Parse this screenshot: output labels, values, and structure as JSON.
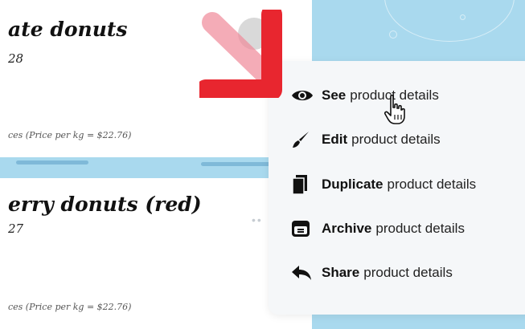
{
  "cards": [
    {
      "title": "ate donuts",
      "code": "28",
      "price": "ces (Price per kg = $22.76)"
    },
    {
      "title": "erry donuts (red)",
      "code": "27",
      "price": "ces (Price per kg = $22.76)"
    }
  ],
  "menu": {
    "items": [
      {
        "bold": "See",
        "rest": "product details",
        "icon": "eye-icon"
      },
      {
        "bold": "Edit",
        "rest": "product details",
        "icon": "brush-icon"
      },
      {
        "bold": "Duplicate",
        "rest": "product details",
        "icon": "duplicate-icon"
      },
      {
        "bold": "Archive",
        "rest": "product details",
        "icon": "archive-box-icon"
      },
      {
        "bold": "Share",
        "rest": "product details",
        "icon": "share-arrow-icon"
      }
    ]
  },
  "overlay": {
    "annotation_arrow_color": "#e8262f",
    "cursor": "hand-pointer-icon"
  },
  "colors": {
    "background_blue": "#a9d9ee",
    "menu_bg": "#f5f7f9",
    "card_bg": "#ffffff"
  }
}
